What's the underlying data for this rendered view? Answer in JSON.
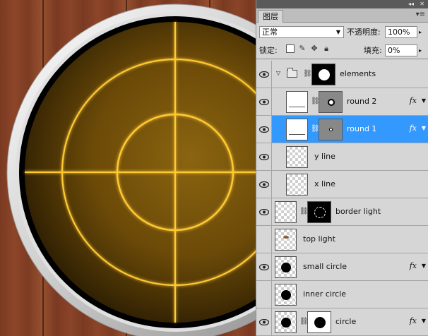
{
  "panel": {
    "tab_label": "图层",
    "menu_icon": "panel-menu-icon",
    "collapse_label": "◂◂",
    "close_label": "✕",
    "blend_mode": "正常",
    "opacity_label": "不透明度:",
    "opacity_value": "100%",
    "lock_label": "锁定:",
    "fill_label": "填充:",
    "fill_value": "0%",
    "fx_label": "fx"
  },
  "layers": [
    {
      "name": "elements",
      "type": "group",
      "visible": true,
      "mask": true
    },
    {
      "name": "round 2",
      "type": "layer",
      "visible": true,
      "mask": true,
      "fx": true,
      "indent": true
    },
    {
      "name": "round 1",
      "type": "layer",
      "visible": true,
      "mask": true,
      "fx": true,
      "indent": true,
      "selected": true
    },
    {
      "name": "y line",
      "type": "layer",
      "visible": true,
      "indent": true
    },
    {
      "name": "x line",
      "type": "layer",
      "visible": true,
      "indent": true
    },
    {
      "name": "border light",
      "type": "layer",
      "visible": true,
      "mask": true
    },
    {
      "name": "top light",
      "type": "layer",
      "visible": false
    },
    {
      "name": "small circle",
      "type": "layer",
      "visible": true,
      "fx": true
    },
    {
      "name": "inner circle",
      "type": "layer",
      "visible": false
    },
    {
      "name": "circle",
      "type": "layer",
      "visible": true,
      "mask": true,
      "fx": true
    }
  ],
  "colors": {
    "selected": "#3399ff",
    "glow": "#ffcc33",
    "radar_fill": "#6b4a08"
  }
}
